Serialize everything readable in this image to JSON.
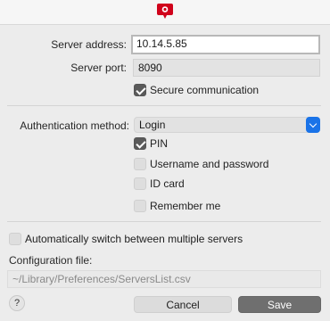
{
  "server": {
    "address_label": "Server address:",
    "address_value": "10.14.5.85",
    "port_label": "Server port:",
    "port_value": "8090",
    "secure_label": "Secure communication",
    "secure_checked": true
  },
  "auth": {
    "method_label": "Authentication method:",
    "method_value": "Login",
    "pin_label": "PIN",
    "username_label": "Username and password",
    "idcard_label": "ID card",
    "remember_label": "Remember me"
  },
  "multi": {
    "auto_switch_label": "Automatically switch between multiple servers",
    "config_label": "Configuration file:",
    "config_value": "~/Library/Preferences/ServersList.csv"
  },
  "buttons": {
    "help": "?",
    "cancel": "Cancel",
    "save": "Save"
  },
  "colors": {
    "logo": "#d0021b",
    "dropdown_accent": "#1a73e8"
  }
}
